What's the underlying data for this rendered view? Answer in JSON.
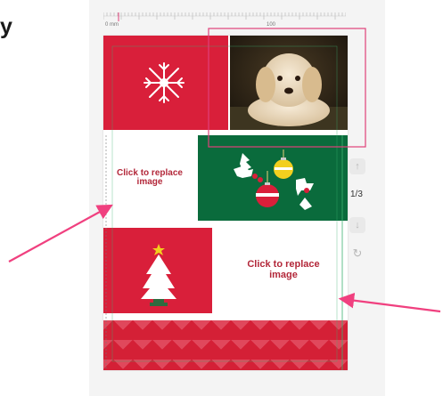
{
  "heading": "y",
  "ruler": {
    "start_label": "0 mm",
    "mid_label": "100"
  },
  "placeholders": {
    "left": "Click to replace image",
    "right": "Click to replace image"
  },
  "pager": {
    "indicator": "1/3"
  },
  "colors": {
    "red": "#d91f3a",
    "green": "#0a6b3c",
    "selection": "#e0407a",
    "arrow": "#f0407f",
    "guide": "#3cb371"
  },
  "icons": {
    "snowflake": "snowflake-icon",
    "ornaments": "ornaments-icon",
    "tree": "christmas-tree-icon",
    "up": "arrow-up-icon",
    "down": "arrow-down-icon",
    "refresh": "refresh-icon"
  }
}
